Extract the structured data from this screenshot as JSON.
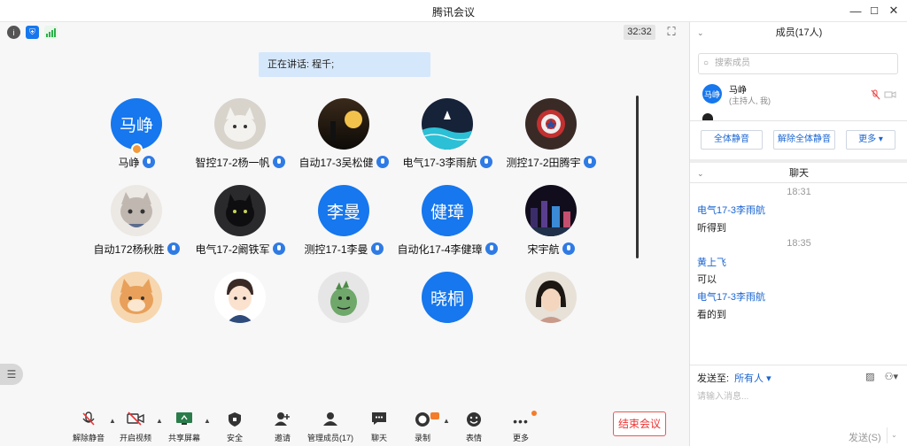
{
  "window": {
    "title": "腾讯会议",
    "controls": [
      "—",
      "☐",
      "✕"
    ]
  },
  "topbar": {
    "timer": "32:32",
    "icons": [
      "info-icon",
      "shield-icon",
      "signal-icon",
      "fullscreen-icon"
    ]
  },
  "speaking": "正在讲话: 程千;",
  "participants": [
    {
      "name": "马峥",
      "avatar_text": "马峥",
      "style": "blue",
      "host": true
    },
    {
      "name": "智控17-2杨一帆",
      "avatar_text": "",
      "style": "cat-white"
    },
    {
      "name": "自动17-3吴松健",
      "avatar_text": "",
      "style": "sunset"
    },
    {
      "name": "电气17-3李雨航",
      "avatar_text": "",
      "style": "night-sea"
    },
    {
      "name": "测控17-2田腾宇",
      "avatar_text": "",
      "style": "shield"
    },
    {
      "name": "自动172杨秋胜",
      "avatar_text": "",
      "style": "grey-cat"
    },
    {
      "name": "电气17-2阚铁军",
      "avatar_text": "",
      "style": "black-cat"
    },
    {
      "name": "测控17-1李曼",
      "avatar_text": "李曼",
      "style": "blue"
    },
    {
      "name": "自动化17-4李健璋",
      "avatar_text": "健璋",
      "style": "blue"
    },
    {
      "name": "宋宇航",
      "avatar_text": "",
      "style": "city-night"
    },
    {
      "name": "",
      "avatar_text": "",
      "style": "orange-cat"
    },
    {
      "name": "",
      "avatar_text": "",
      "style": "cartoon-boy"
    },
    {
      "name": "",
      "avatar_text": "",
      "style": "dino"
    },
    {
      "name": "",
      "avatar_text": "晓桐",
      "style": "blue"
    },
    {
      "name": "",
      "avatar_text": "",
      "style": "girl"
    }
  ],
  "toolbar": {
    "items": [
      {
        "id": "unmute",
        "label": "解除静音",
        "icon": "🎤̸"
      },
      {
        "id": "video",
        "label": "开启视频",
        "icon": "📹"
      },
      {
        "id": "share",
        "label": "共享屏幕",
        "icon": "🖥"
      },
      {
        "id": "security",
        "label": "安全",
        "icon": "🛡"
      },
      {
        "id": "invite",
        "label": "邀请",
        "icon": "👤"
      },
      {
        "id": "members",
        "label": "管理成员(17)",
        "icon": "👥"
      },
      {
        "id": "chat",
        "label": "聊天",
        "icon": "💬"
      },
      {
        "id": "record",
        "label": "录制",
        "icon": "⏺"
      },
      {
        "id": "emoji",
        "label": "表情",
        "icon": "☺"
      },
      {
        "id": "more",
        "label": "更多",
        "icon": "•••"
      }
    ],
    "end_label": "结束会议"
  },
  "members_panel": {
    "title": "成员(17人)",
    "search_placeholder": "搜索成员",
    "member": {
      "name": "马峥",
      "role": "(主持人, 我)",
      "avatar_text": "马峥"
    },
    "buttons": [
      "全体静音",
      "解除全体静音",
      "更多 ▾"
    ]
  },
  "chat_panel": {
    "title": "聊天",
    "messages": [
      {
        "time": "18:31"
      },
      {
        "sender": "电气17-3李雨航",
        "text": "听得到"
      },
      {
        "time": "18:35"
      },
      {
        "sender": "黄上飞",
        "text": "可以"
      },
      {
        "sender": "电气17-3李雨航",
        "text": "看的到"
      }
    ],
    "send_to_label": "发送至:",
    "send_to_value": "所有人 ▾",
    "input_placeholder": "请输入消息...",
    "send_label": "发送(S)"
  },
  "colors": {
    "accent": "#1677ee",
    "end": "#e33333",
    "highlight": "#d5e7fb"
  }
}
